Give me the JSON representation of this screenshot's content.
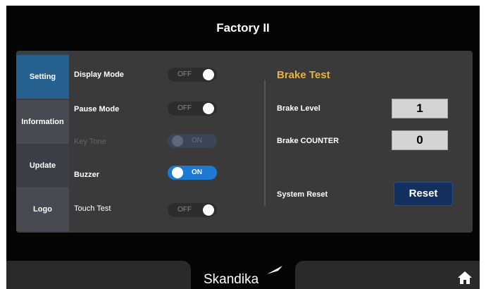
{
  "header": {
    "title": "Factory II"
  },
  "sidebar": {
    "items": [
      {
        "label": "Setting"
      },
      {
        "label": "Information"
      },
      {
        "label": "Update"
      },
      {
        "label": "Logo"
      }
    ]
  },
  "settings": [
    {
      "label": "Display Mode",
      "toggle": "OFF"
    },
    {
      "label": "Pause Mode",
      "toggle": "OFF"
    },
    {
      "label": "Key Tone",
      "toggle": "ON"
    },
    {
      "label": "Buzzer",
      "toggle": "ON"
    },
    {
      "label": "Touch Test",
      "toggle": "OFF"
    }
  ],
  "brake": {
    "title": "Brake Test",
    "level_label": "Brake Level",
    "level_value": "1",
    "counter_label": "Brake COUNTER",
    "counter_value": "0",
    "reset_label": "System Reset",
    "reset_button": "Reset"
  },
  "footer": {
    "brand": "Skandika"
  },
  "icons": {
    "home": "home-icon",
    "logo": "skandika-logo-icon"
  },
  "colors": {
    "accent": "#1c7ad4",
    "active_tab": "#27618f",
    "title_gold": "#e8b33d",
    "reset_button": "#13305f"
  }
}
